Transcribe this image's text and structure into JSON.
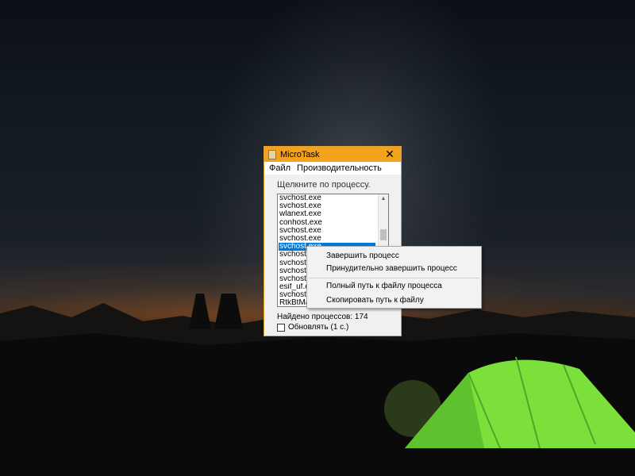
{
  "window": {
    "title": "MicroTask",
    "close_symbol": "✕"
  },
  "menu": {
    "file": "Файл",
    "performance": "Производительность"
  },
  "hint": "Щелкните по процессу.",
  "processes": [
    "svchost.exe",
    "svchost.exe",
    "wlanext.exe",
    "conhost.exe",
    "svchost.exe",
    "svchost.exe",
    "svchost.exe",
    "svchost.exe",
    "svchost.exe",
    "svchost.exe",
    "svchost.exe",
    "esif_uf.exe",
    "svchost.exe",
    "RtkBtMa"
  ],
  "selected_index": 6,
  "status": "Найдено процессов: 174",
  "refresh_label": "Обновлять (1 с.)",
  "context_menu": {
    "end_process": "Завершить процесс",
    "force_end_process": "Принудительно завершить процесс",
    "full_path": "Полный путь к файлу процесса",
    "copy_path": "Скопировать путь к файлу"
  },
  "colors": {
    "titlebar": "#f3a21c",
    "selection": "#0078d7",
    "tent": "#7be03a"
  },
  "icons": {
    "app": "app-icon",
    "close": "close-icon",
    "scroll_up": "chevron-up-icon",
    "scroll_down": "chevron-down-icon"
  }
}
